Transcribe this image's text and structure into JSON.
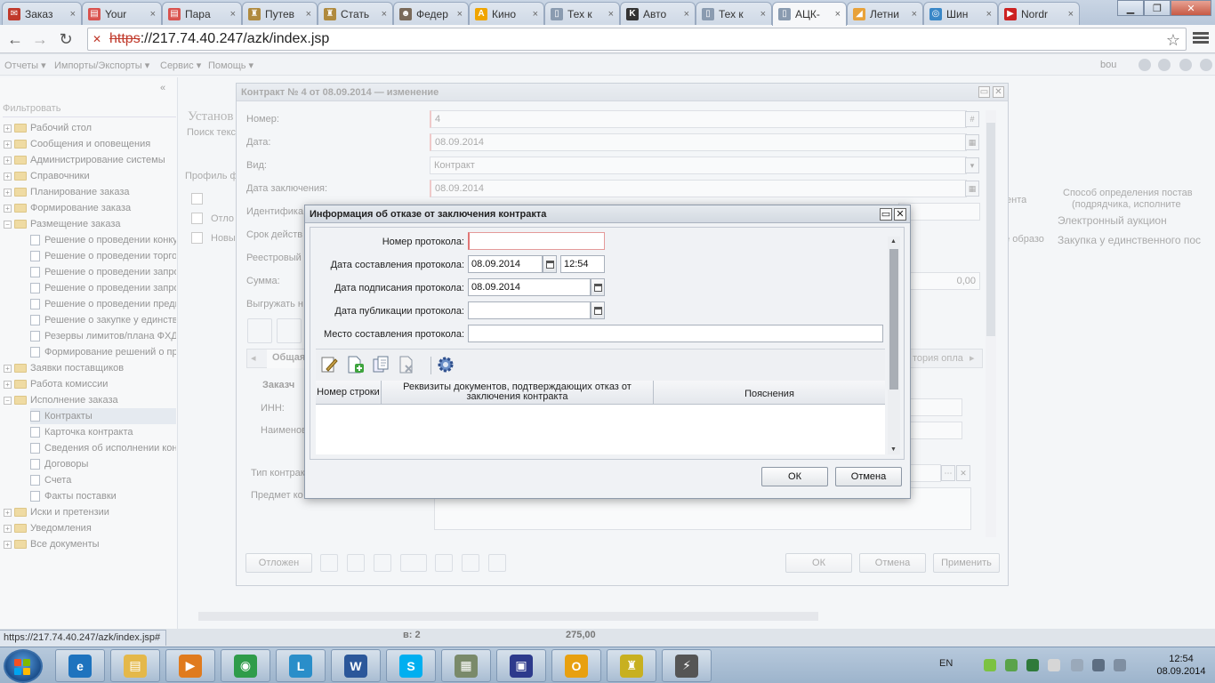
{
  "browser": {
    "tabs": [
      {
        "title": "Заказ",
        "fav_color": "#c0392b",
        "fav_glyph": "✉"
      },
      {
        "title": "Your",
        "fav_color": "#d9534f",
        "fav_glyph": "▤"
      },
      {
        "title": "Пара",
        "fav_color": "#d9534f",
        "fav_glyph": "▤"
      },
      {
        "title": "Путев",
        "fav_color": "#b08a3e",
        "fav_glyph": "♜"
      },
      {
        "title": "Стать",
        "fav_color": "#b08a3e",
        "fav_glyph": "♜"
      },
      {
        "title": "Федер",
        "fav_color": "#7a6a5a",
        "fav_glyph": "☻"
      },
      {
        "title": "Кино",
        "fav_color": "#f0a500",
        "fav_glyph": "A"
      },
      {
        "title": "Тех к",
        "fav_color": "#8a9bb0",
        "fav_glyph": "▯"
      },
      {
        "title": "Авто",
        "fav_color": "#333333",
        "fav_glyph": "K"
      },
      {
        "title": "Тех к",
        "fav_color": "#8a9bb0",
        "fav_glyph": "▯"
      },
      {
        "title": "АЦК-",
        "fav_color": "#8a9bb0",
        "fav_glyph": "▯"
      },
      {
        "title": "Летни",
        "fav_color": "#e8a23a",
        "fav_glyph": "◢"
      },
      {
        "title": "Шин",
        "fav_color": "#3a87c7",
        "fav_glyph": "◎"
      },
      {
        "title": "Nordr",
        "fav_color": "#cc2222",
        "fav_glyph": "▶"
      }
    ],
    "url_scheme": "https",
    "url_rest": "://217.74.40.247/azk/index.jsp",
    "status_url": "https://217.74.40.247/azk/index.jsp#"
  },
  "app": {
    "menu": [
      "Отчеты",
      "Импорты/Экспорты",
      "Сервис",
      "Помощь"
    ],
    "user": "bou",
    "sidebar": {
      "filter": "Фильтровать",
      "items": [
        {
          "label": "Рабочий стол",
          "level": 0,
          "kind": "folder"
        },
        {
          "label": "Сообщения и оповещения",
          "level": 0,
          "kind": "folder"
        },
        {
          "label": "Администрирование системы",
          "level": 0,
          "kind": "folder"
        },
        {
          "label": "Справочники",
          "level": 0,
          "kind": "folder"
        },
        {
          "label": "Планирование заказа",
          "level": 0,
          "kind": "folder"
        },
        {
          "label": "Формирование заказа",
          "level": 0,
          "kind": "folder"
        },
        {
          "label": "Размещение заказа",
          "level": 0,
          "kind": "folder-open"
        },
        {
          "label": "Решение о проведении конку",
          "level": 1,
          "kind": "doc"
        },
        {
          "label": "Решение о проведении торго",
          "level": 1,
          "kind": "doc"
        },
        {
          "label": "Решение о проведении запро",
          "level": 1,
          "kind": "doc"
        },
        {
          "label": "Решение о проведении запро",
          "level": 1,
          "kind": "doc"
        },
        {
          "label": "Решение о проведении предв",
          "level": 1,
          "kind": "doc"
        },
        {
          "label": "Решение о закупке у единстве",
          "level": 1,
          "kind": "doc"
        },
        {
          "label": "Резервы лимитов/плана ФХД",
          "level": 1,
          "kind": "doc"
        },
        {
          "label": "Формирование решений о пр",
          "level": 1,
          "kind": "doc"
        },
        {
          "label": "Заявки поставщиков",
          "level": 0,
          "kind": "folder"
        },
        {
          "label": "Работа комиссии",
          "level": 0,
          "kind": "folder"
        },
        {
          "label": "Исполнение заказа",
          "level": 0,
          "kind": "folder-open"
        },
        {
          "label": "Контракты",
          "level": 1,
          "kind": "doc",
          "selected": true
        },
        {
          "label": "Карточка контракта",
          "level": 1,
          "kind": "doc"
        },
        {
          "label": "Сведения об исполнении конт",
          "level": 1,
          "kind": "doc"
        },
        {
          "label": "Договоры",
          "level": 1,
          "kind": "doc"
        },
        {
          "label": "Счета",
          "level": 1,
          "kind": "doc"
        },
        {
          "label": "Факты поставки",
          "level": 1,
          "kind": "doc"
        },
        {
          "label": "Иски и претензии",
          "level": 0,
          "kind": "folder"
        },
        {
          "label": "Уведомления",
          "level": 0,
          "kind": "folder"
        },
        {
          "label": "Все документы",
          "level": 0,
          "kind": "folder"
        }
      ]
    },
    "background": {
      "title": "Установ",
      "search": "Поиск текс",
      "profile": "Профиль ф",
      "rows": [
        "Отло",
        "Новы"
      ],
      "col_enta": "ента",
      "col_method": "Способ определения постав",
      "col_method2": "(подрядчика, исполните",
      "row1_method": "Электронный аукцион",
      "row2_method": "Закупка у единственного пос",
      "row2_prefix": "ре образо",
      "footer_count": "в: 2",
      "footer_sum": "275,00"
    }
  },
  "contract_window": {
    "title": "Контракт № 4 от 08.09.2014 — изменение",
    "fields": {
      "number_label": "Номер:",
      "number": "4",
      "date_label": "Дата:",
      "date": "08.09.2014",
      "kind_label": "Вид:",
      "kind": "Контракт",
      "sign_date_label": "Дата заключения:",
      "sign_date": "08.09.2014",
      "ident_label": "Идентифика",
      "term_label": "Срок действ",
      "registry_label": "Реестровый",
      "sum_label": "Сумма:",
      "sum": "0,00",
      "export_label": "Выгружать н",
      "tab_general": "Общая",
      "tab_history": "тория опла",
      "customer_label": "Заказч",
      "inn_label": "ИНН:",
      "name_label": "Наименов",
      "contract_type_label": "Тип контрак",
      "subject_label": "Предмет ко"
    },
    "buttons": {
      "postponed": "Отложен",
      "ok": "ОК",
      "cancel": "Отмена",
      "apply": "Применить"
    }
  },
  "dialog": {
    "title": "Информация об отказе от заключения контракта",
    "fields": {
      "protocol_number_label": "Номер протокола:",
      "protocol_number": "",
      "compose_date_label": "Дата составления протокола:",
      "compose_date": "08.09.2014",
      "compose_time": "12:54",
      "sign_date_label": "Дата подписания протокола:",
      "sign_date": "08.09.2014",
      "publish_date_label": "Дата публикации протокола:",
      "publish_date": "",
      "place_label": "Место составления протокола:",
      "place": ""
    },
    "grid": {
      "col_row_number": "Номер строки",
      "col_requisites": "Реквизиты документов, подтверждающих отказ от заключения контракта",
      "col_notes": "Пояснения"
    },
    "buttons": {
      "ok": "ОК",
      "cancel": "Отмена"
    }
  },
  "taskbar": {
    "lang": "EN",
    "time": "12:54",
    "date": "08.09.2014",
    "apps": [
      {
        "name": "ie",
        "color": "#1e73be",
        "glyph": "e"
      },
      {
        "name": "explorer",
        "color": "#e4b84a",
        "glyph": "▤"
      },
      {
        "name": "media-player",
        "color": "#e07b1e",
        "glyph": "▶"
      },
      {
        "name": "chrome",
        "color": "#2f9c4a",
        "glyph": "◉"
      },
      {
        "name": "lync",
        "color": "#2a8ec9",
        "glyph": "L"
      },
      {
        "name": "word",
        "color": "#2b579a",
        "glyph": "W"
      },
      {
        "name": "skype",
        "color": "#00aff0",
        "glyph": "S"
      },
      {
        "name": "spreadsheet-app",
        "color": "#7a8a6a",
        "glyph": "▦"
      },
      {
        "name": "save-app",
        "color": "#2d3a8c",
        "glyph": "▣"
      },
      {
        "name": "outlook",
        "color": "#e8a010",
        "glyph": "O"
      },
      {
        "name": "network-app",
        "color": "#c8b020",
        "glyph": "♜"
      },
      {
        "name": "connection-app",
        "color": "#555555",
        "glyph": "⚡"
      }
    ]
  }
}
